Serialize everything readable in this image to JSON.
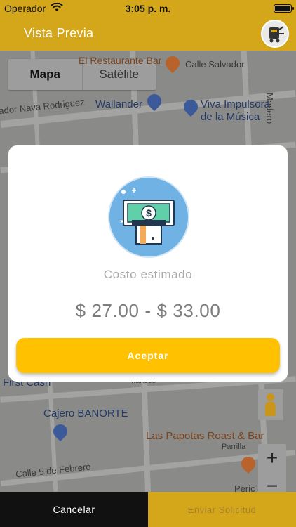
{
  "status_bar": {
    "carrier": "Operador",
    "time": "3:05 p. m."
  },
  "nav": {
    "title": "Vista Previa"
  },
  "map": {
    "type_toggle": {
      "map_label": "Mapa",
      "satellite_label": "Satélite"
    },
    "labels": {
      "restaurant_partial": "El Restaurante Bar",
      "street_salvador": "Calle Salvador",
      "street_madero": "Madero",
      "street_nava": "ador Nava Rodriguez",
      "wallander": "Wallander",
      "viva_line1": "Viva Impulsora",
      "viva_line2": "de la Música",
      "first_cash": "First Cash",
      "mansco": "Mansco",
      "cajero": "Cajero BANORTE",
      "papotas": "Las Papotas Roast & Bar",
      "parrilla": "Parrilla",
      "febrero": "Calle 5 de Febrero",
      "peric": "Peric"
    },
    "zoom_in": "+",
    "zoom_out": "−"
  },
  "dialog": {
    "icon": "money-bill-icon",
    "caption": "Costo estimado",
    "price": "$ 27.00 - $ 33.00",
    "accept_label": "Aceptar"
  },
  "bottom": {
    "cancel_label": "Cancelar",
    "send_label": "Enviar Solicitud"
  },
  "colors": {
    "brand_yellow": "#d4a61a",
    "accept_button": "#ffc100",
    "icon_circle": "#6fb2e3"
  }
}
